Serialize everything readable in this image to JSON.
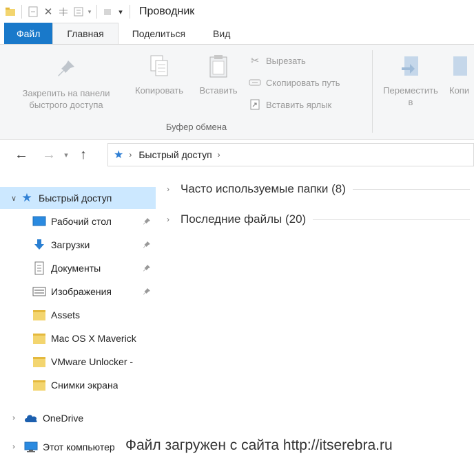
{
  "window": {
    "title": "Проводник"
  },
  "ribbon_tabs": [
    "Файл",
    "Главная",
    "Поделиться",
    "Вид"
  ],
  "ribbon": {
    "pin_label_line1": "Закрепить на панели",
    "pin_label_line2": "быстрого доступа",
    "copy_label": "Копировать",
    "paste_label": "Вставить",
    "cut_label": "Вырезать",
    "copy_path_label": "Скопировать путь",
    "paste_shortcut_label": "Вставить ярлык",
    "clipboard_group_label": "Буфер обмена",
    "move_label": "Переместить",
    "move_sub_label": "в",
    "copy_to_label": "Копи"
  },
  "address": {
    "crumb": "Быстрый доступ"
  },
  "nav": {
    "quick_access": "Быстрый доступ",
    "items": [
      "Рабочий стол",
      "Загрузки",
      "Документы",
      "Изображения",
      "Assets",
      "Mac OS X Maverick",
      "VMware Unlocker -",
      "Снимки экрана"
    ],
    "onedrive": "OneDrive",
    "this_pc": "Этот компьютер"
  },
  "content": {
    "frequent_folders": "Часто используемые папки (8)",
    "recent_files": "Последние файлы (20)"
  },
  "watermark": "Файл загружен с сайта http://itserebra.ru",
  "colors": {
    "file_tab": "#1979ca",
    "selection": "#cce8ff",
    "folder": "#f3d56f"
  }
}
